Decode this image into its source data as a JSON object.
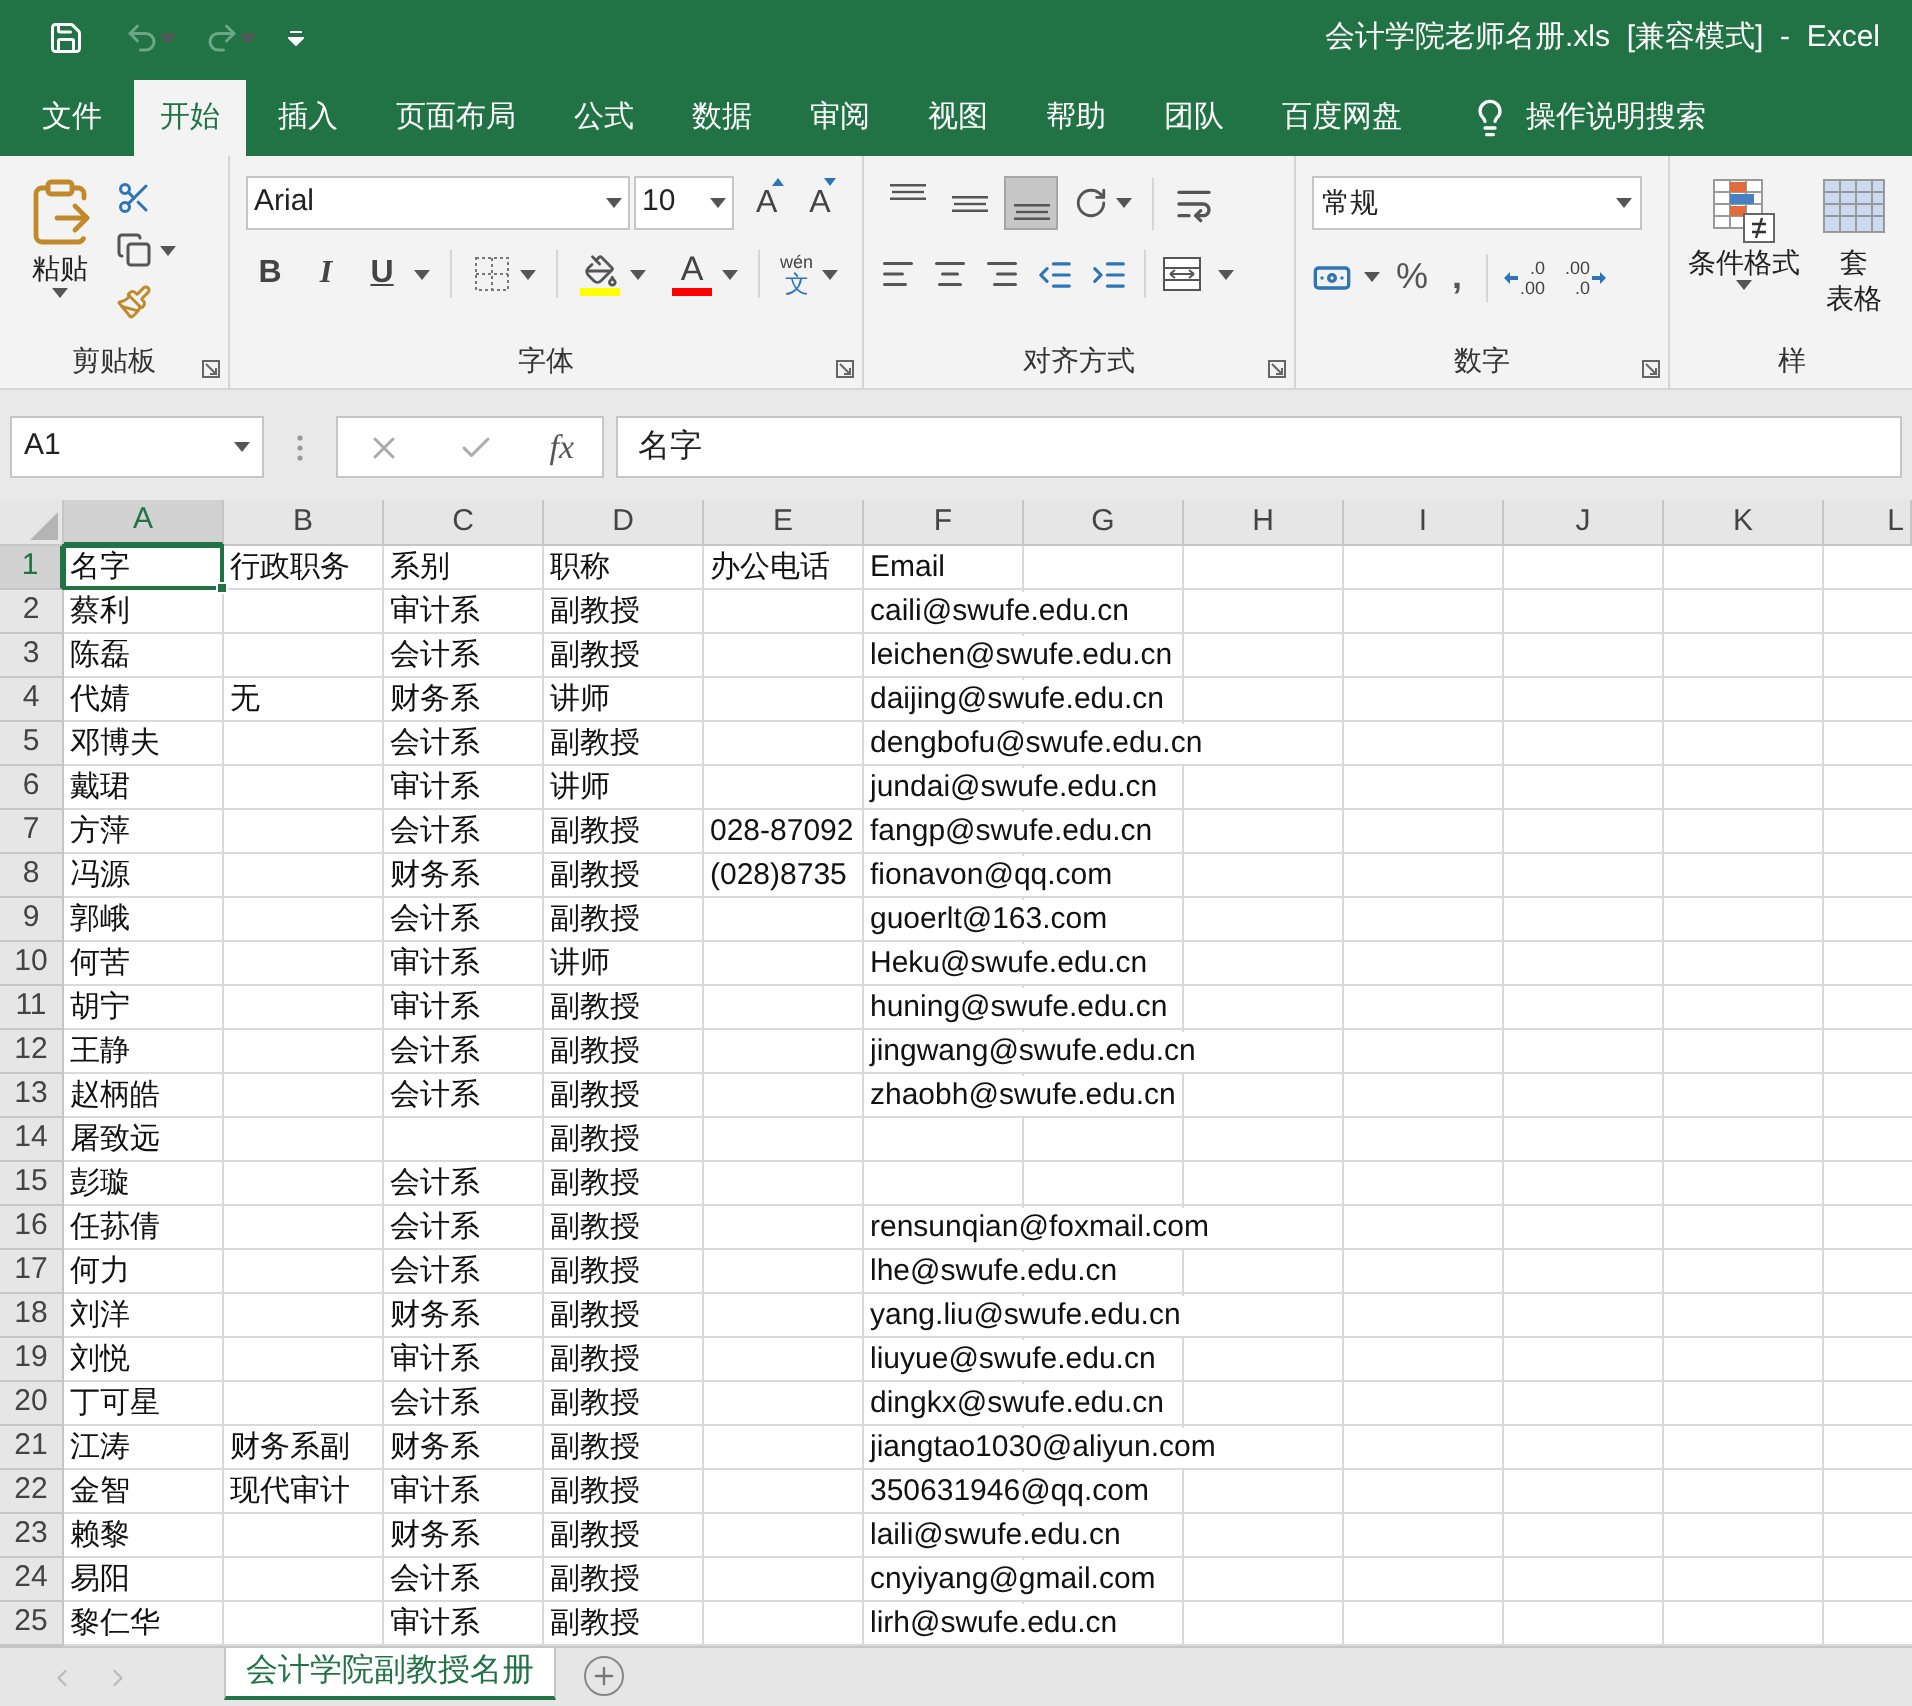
{
  "title_bar": {
    "title": "会计学院老师名册.xls  [兼容模式]  -  Excel"
  },
  "tabs": [
    {
      "label": "文件",
      "selected": false
    },
    {
      "label": "开始",
      "selected": true
    },
    {
      "label": "插入",
      "selected": false
    },
    {
      "label": "页面布局",
      "selected": false
    },
    {
      "label": "公式",
      "selected": false
    },
    {
      "label": "数据",
      "selected": false
    },
    {
      "label": "审阅",
      "selected": false
    },
    {
      "label": "视图",
      "selected": false
    },
    {
      "label": "帮助",
      "selected": false
    },
    {
      "label": "团队",
      "selected": false
    },
    {
      "label": "百度网盘",
      "selected": false
    }
  ],
  "tell_me": "操作说明搜索",
  "ribbon": {
    "clipboard": {
      "label": "剪贴板",
      "paste": "粘贴"
    },
    "font": {
      "label": "字体",
      "font_name": "Arial",
      "font_size": "10",
      "grow": "A",
      "shrink": "A",
      "styles": [
        {
          "kind": "bold",
          "label": "B"
        },
        {
          "kind": "italic",
          "label": "I"
        },
        {
          "kind": "underline",
          "label": "U"
        }
      ],
      "font_color": "A",
      "phonetic": {
        "top": "wén",
        "bottom": "文"
      }
    },
    "alignment": {
      "label": "对齐方式",
      "vertical": [
        {
          "selected": false
        },
        {
          "selected": false
        },
        {
          "selected": true
        }
      ]
    },
    "number": {
      "label": "数字",
      "format": "常规",
      "percent": "%",
      "comma": ",",
      "increase_decimal": {
        "top": ".0",
        "bottom": ".00"
      },
      "decrease_decimal": {
        "top": ".00",
        "bottom": ".0"
      }
    },
    "styles": {
      "conditional": "条件格式",
      "table_top": "套",
      "table_bottom": "表格",
      "label": "样"
    }
  },
  "formula_bar": {
    "name_box": "A1",
    "fx": "fx",
    "formula": "名字"
  },
  "columns": [
    {
      "label": "A",
      "selected": true
    },
    {
      "label": "B",
      "selected": false
    },
    {
      "label": "C",
      "selected": false
    },
    {
      "label": "D",
      "selected": false
    },
    {
      "label": "E",
      "selected": false
    },
    {
      "label": "F",
      "selected": false
    },
    {
      "label": "G",
      "selected": false
    },
    {
      "label": "H",
      "selected": false
    },
    {
      "label": "I",
      "selected": false
    },
    {
      "label": "J",
      "selected": false
    },
    {
      "label": "K",
      "selected": false
    },
    {
      "label": "L",
      "selected": false
    }
  ],
  "rows": [
    {
      "number": "1",
      "selected": true,
      "cells": {
        "a": "名字",
        "b": "行政职务",
        "c": "系别",
        "d": "职称",
        "e": "办公电话",
        "f": "Email"
      }
    },
    {
      "number": "2",
      "selected": false,
      "cells": {
        "a": "蔡利",
        "c": "审计系",
        "d": "副教授",
        "f": "caili@swufe.edu.cn"
      }
    },
    {
      "number": "3",
      "selected": false,
      "cells": {
        "a": "陈磊",
        "c": "会计系",
        "d": "副教授",
        "f": "leichen@swufe.edu.cn"
      }
    },
    {
      "number": "4",
      "selected": false,
      "cells": {
        "a": "代婧",
        "b": "无",
        "c": "财务系",
        "d": "讲师",
        "f": "daijing@swufe.edu.cn"
      }
    },
    {
      "number": "5",
      "selected": false,
      "cells": {
        "a": "邓博夫",
        "c": "会计系",
        "d": "副教授",
        "f": "dengbofu@swufe.edu.cn"
      }
    },
    {
      "number": "6",
      "selected": false,
      "cells": {
        "a": "戴珺",
        "c": "审计系",
        "d": "讲师",
        "f": "jundai@swufe.edu.cn"
      }
    },
    {
      "number": "7",
      "selected": false,
      "cells": {
        "a": "方萍",
        "c": "会计系",
        "d": "副教授",
        "e": "028-87092",
        "f": "fangp@swufe.edu.cn"
      }
    },
    {
      "number": "8",
      "selected": false,
      "cells": {
        "a": "冯源",
        "c": "财务系",
        "d": "副教授",
        "e": "(028)8735",
        "f": "fionavon@qq.com"
      }
    },
    {
      "number": "9",
      "selected": false,
      "cells": {
        "a": "郭峨",
        "c": "会计系",
        "d": "副教授",
        "f": "guoerlt@163.com"
      }
    },
    {
      "number": "10",
      "selected": false,
      "cells": {
        "a": "何苦",
        "c": "审计系",
        "d": "讲师",
        "f": "Heku@swufe.edu.cn"
      }
    },
    {
      "number": "11",
      "selected": false,
      "cells": {
        "a": "胡宁",
        "c": "审计系",
        "d": "副教授",
        "f": "huning@swufe.edu.cn"
      }
    },
    {
      "number": "12",
      "selected": false,
      "cells": {
        "a": "王静",
        "c": "会计系",
        "d": "副教授",
        "f": "jingwang@swufe.edu.cn"
      }
    },
    {
      "number": "13",
      "selected": false,
      "cells": {
        "a": "赵柄皓",
        "c": "会计系",
        "d": "副教授",
        "f": "zhaobh@swufe.edu.cn"
      }
    },
    {
      "number": "14",
      "selected": false,
      "cells": {
        "a": "屠致远",
        "d": "副教授"
      }
    },
    {
      "number": "15",
      "selected": false,
      "cells": {
        "a": "彭璇",
        "c": "会计系",
        "d": "副教授"
      }
    },
    {
      "number": "16",
      "selected": false,
      "cells": {
        "a": "任荪倩",
        "c": "会计系",
        "d": "副教授",
        "f": "rensunqian@foxmail.com"
      }
    },
    {
      "number": "17",
      "selected": false,
      "cells": {
        "a": "何力",
        "c": "会计系",
        "d": "副教授",
        "f": "lhe@swufe.edu.cn"
      }
    },
    {
      "number": "18",
      "selected": false,
      "cells": {
        "a": "刘洋",
        "c": "财务系",
        "d": "副教授",
        "f": "yang.liu@swufe.edu.cn"
      }
    },
    {
      "number": "19",
      "selected": false,
      "cells": {
        "a": "刘悦",
        "c": "审计系",
        "d": "副教授",
        "f": "liuyue@swufe.edu.cn"
      }
    },
    {
      "number": "20",
      "selected": false,
      "cells": {
        "a": "丁可星",
        "c": "会计系",
        "d": "副教授",
        "f": "dingkx@swufe.edu.cn"
      }
    },
    {
      "number": "21",
      "selected": false,
      "cells": {
        "a": "江涛",
        "b": "财务系副",
        "c": "财务系",
        "d": "副教授",
        "f": "jiangtao1030@aliyun.com"
      }
    },
    {
      "number": "22",
      "selected": false,
      "cells": {
        "a": "金智",
        "b": "现代审计",
        "c": "审计系",
        "d": "副教授",
        "f": "350631946@qq.com"
      }
    },
    {
      "number": "23",
      "selected": false,
      "cells": {
        "a": "赖黎",
        "c": "财务系",
        "d": "副教授",
        "f": "laili@swufe.edu.cn"
      }
    },
    {
      "number": "24",
      "selected": false,
      "cells": {
        "a": "易阳",
        "c": "会计系",
        "d": "副教授",
        "f": "cnyiyang@gmail.com"
      }
    },
    {
      "number": "25",
      "selected": false,
      "cells": {
        "a": "黎仁华",
        "c": "审计系",
        "d": "副教授",
        "f": "lirh@swufe.edu.cn"
      }
    }
  ],
  "sheet_tabs": [
    {
      "label": "会计学院副教授名册",
      "selected": true
    }
  ]
}
